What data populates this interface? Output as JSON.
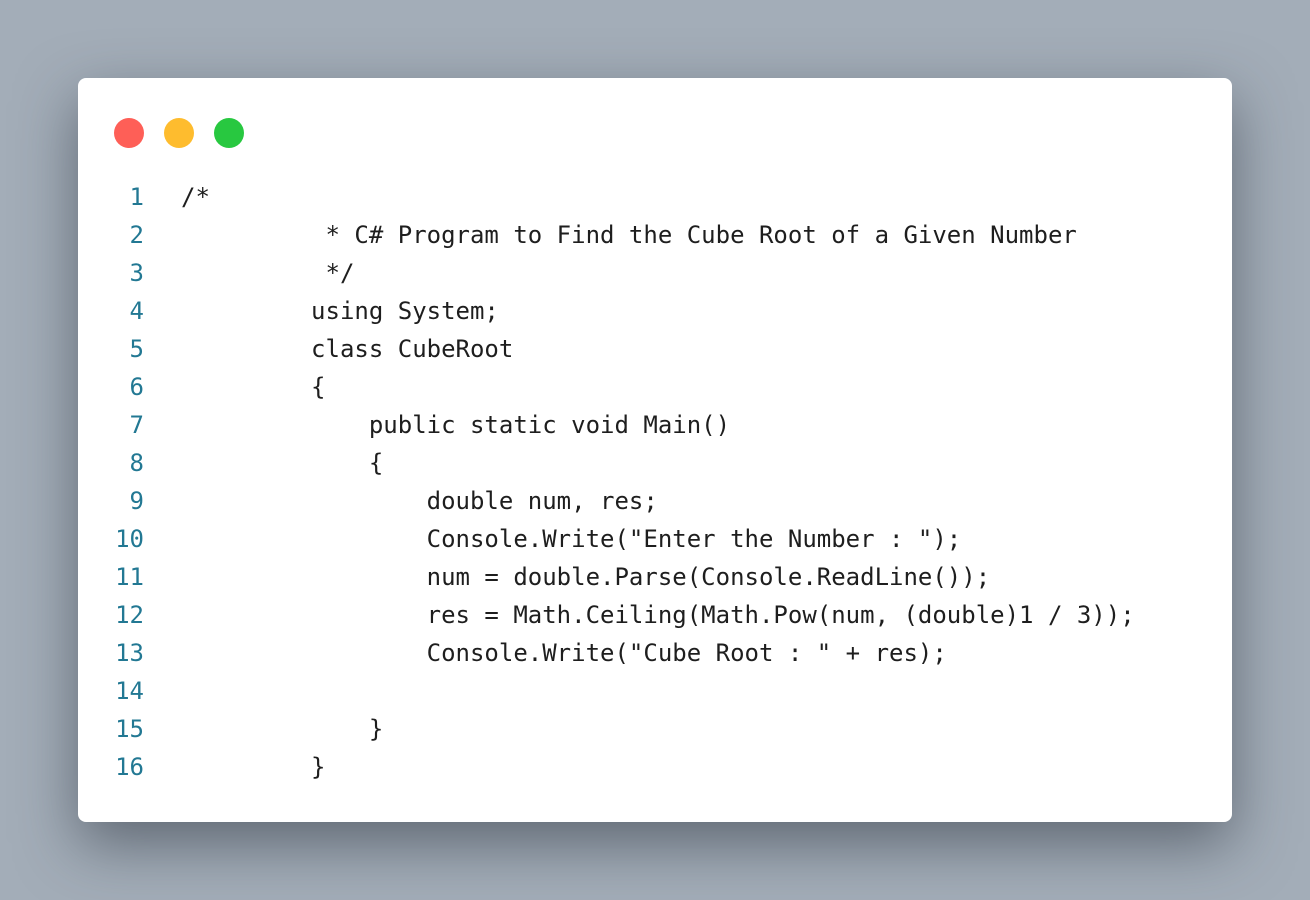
{
  "window": {
    "controls": {
      "close_color": "#fe5f57",
      "minimize_color": "#febc2e",
      "maximize_color": "#28c840"
    }
  },
  "code": {
    "language": "C#",
    "lines": [
      {
        "number": "1",
        "text": "/*"
      },
      {
        "number": "2",
        "text": "          * C# Program to Find the Cube Root of a Given Number"
      },
      {
        "number": "3",
        "text": "          */"
      },
      {
        "number": "4",
        "text": "         using System;"
      },
      {
        "number": "5",
        "text": "         class CubeRoot"
      },
      {
        "number": "6",
        "text": "         {"
      },
      {
        "number": "7",
        "text": "             public static void Main()"
      },
      {
        "number": "8",
        "text": "             {"
      },
      {
        "number": "9",
        "text": "                 double num, res;"
      },
      {
        "number": "10",
        "text": "                 Console.Write(\"Enter the Number : \");"
      },
      {
        "number": "11",
        "text": "                 num = double.Parse(Console.ReadLine());"
      },
      {
        "number": "12",
        "text": "                 res = Math.Ceiling(Math.Pow(num, (double)1 / 3));"
      },
      {
        "number": "13",
        "text": "                 Console.Write(\"Cube Root : \" + res);"
      },
      {
        "number": "14",
        "text": ""
      },
      {
        "number": "15",
        "text": "             }"
      },
      {
        "number": "16",
        "text": "         }"
      }
    ]
  }
}
